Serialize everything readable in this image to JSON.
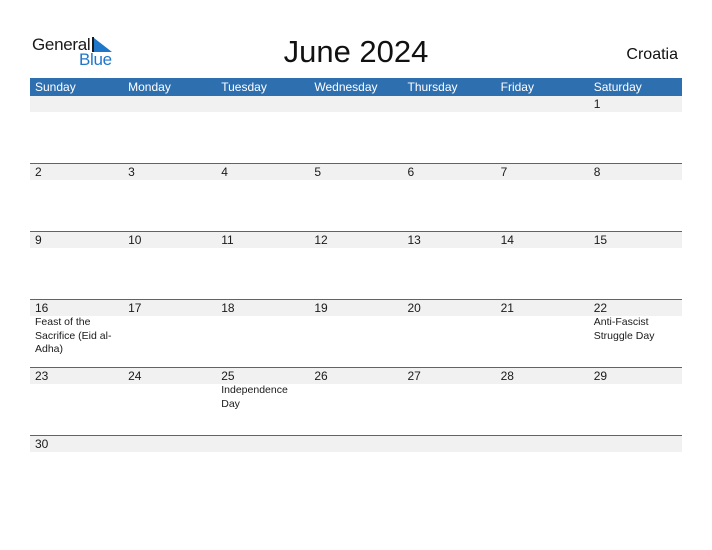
{
  "logo": {
    "general": "General",
    "blue": "Blue",
    "brand_color": "#1f77c9"
  },
  "title": "June 2024",
  "country": "Croatia",
  "colors": {
    "header_bg": "#2e6fb0",
    "day_bar_bg": "#f1f1f1"
  },
  "weekdays": [
    "Sunday",
    "Monday",
    "Tuesday",
    "Wednesday",
    "Thursday",
    "Friday",
    "Saturday"
  ],
  "weeks": [
    [
      {
        "day": "",
        "holiday": ""
      },
      {
        "day": "",
        "holiday": ""
      },
      {
        "day": "",
        "holiday": ""
      },
      {
        "day": "",
        "holiday": ""
      },
      {
        "day": "",
        "holiday": ""
      },
      {
        "day": "",
        "holiday": ""
      },
      {
        "day": "1",
        "holiday": ""
      }
    ],
    [
      {
        "day": "2",
        "holiday": ""
      },
      {
        "day": "3",
        "holiday": ""
      },
      {
        "day": "4",
        "holiday": ""
      },
      {
        "day": "5",
        "holiday": ""
      },
      {
        "day": "6",
        "holiday": ""
      },
      {
        "day": "7",
        "holiday": ""
      },
      {
        "day": "8",
        "holiday": ""
      }
    ],
    [
      {
        "day": "9",
        "holiday": ""
      },
      {
        "day": "10",
        "holiday": ""
      },
      {
        "day": "11",
        "holiday": ""
      },
      {
        "day": "12",
        "holiday": ""
      },
      {
        "day": "13",
        "holiday": ""
      },
      {
        "day": "14",
        "holiday": ""
      },
      {
        "day": "15",
        "holiday": ""
      }
    ],
    [
      {
        "day": "16",
        "holiday": "Feast of the Sacrifice (Eid al-Adha)"
      },
      {
        "day": "17",
        "holiday": ""
      },
      {
        "day": "18",
        "holiday": ""
      },
      {
        "day": "19",
        "holiday": ""
      },
      {
        "day": "20",
        "holiday": ""
      },
      {
        "day": "21",
        "holiday": ""
      },
      {
        "day": "22",
        "holiday": "Anti-Fascist Struggle Day"
      }
    ],
    [
      {
        "day": "23",
        "holiday": ""
      },
      {
        "day": "24",
        "holiday": ""
      },
      {
        "day": "25",
        "holiday": "Independence Day"
      },
      {
        "day": "26",
        "holiday": ""
      },
      {
        "day": "27",
        "holiday": ""
      },
      {
        "day": "28",
        "holiday": ""
      },
      {
        "day": "29",
        "holiday": ""
      }
    ],
    [
      {
        "day": "30",
        "holiday": ""
      },
      {
        "day": "",
        "holiday": ""
      },
      {
        "day": "",
        "holiday": ""
      },
      {
        "day": "",
        "holiday": ""
      },
      {
        "day": "",
        "holiday": ""
      },
      {
        "day": "",
        "holiday": ""
      },
      {
        "day": "",
        "holiday": ""
      }
    ]
  ]
}
